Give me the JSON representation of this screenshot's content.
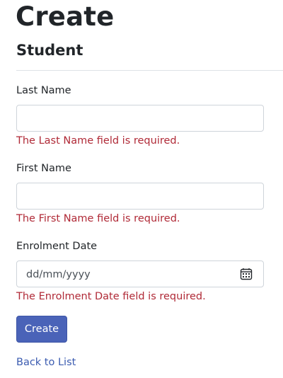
{
  "page": {
    "title": "Create",
    "subtitle": "Student"
  },
  "form": {
    "last_name": {
      "label": "Last Name",
      "value": "",
      "error": "The Last Name field is required."
    },
    "first_name": {
      "label": "First Name",
      "value": "",
      "error": "The First Name field is required."
    },
    "enrolment_date": {
      "label": "Enrolment Date",
      "placeholder": "dd/mm/yyyy",
      "error": "The Enrolment Date field is required.",
      "icon": "calendar-icon"
    },
    "submit_label": "Create"
  },
  "links": {
    "back_to_list": "Back to List"
  },
  "colors": {
    "error": "#b02a37",
    "primary_button": "#4a63b8",
    "link": "#3b5bb0"
  }
}
